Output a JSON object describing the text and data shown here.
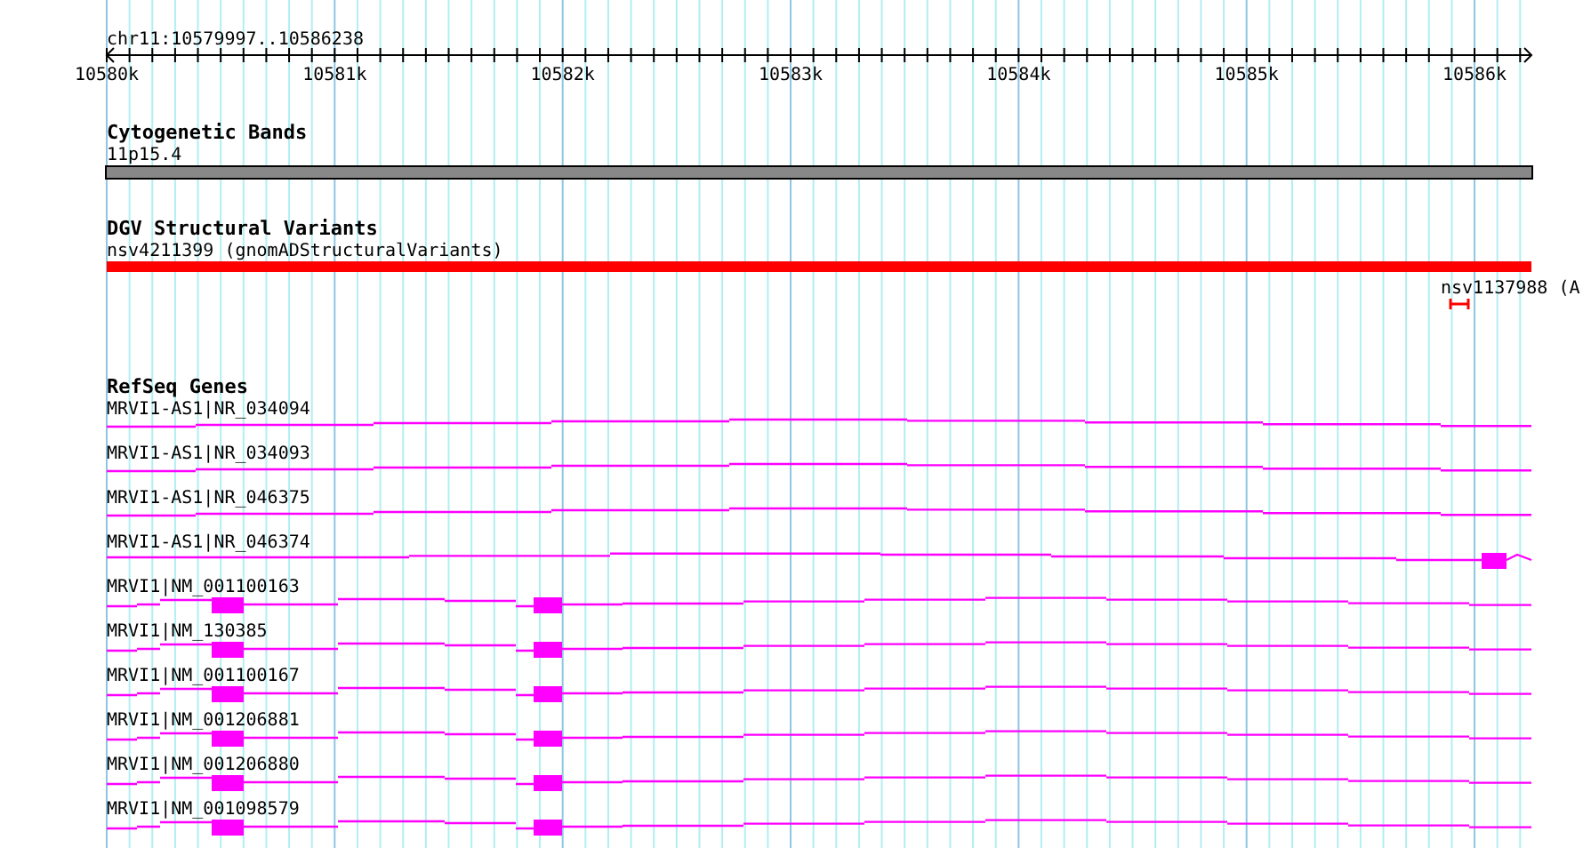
{
  "location": "chr11:10579997..10586238",
  "ruler": {
    "tick_labels": [
      "10580k",
      "10581k",
      "10582k",
      "10583k",
      "10584k",
      "10585k",
      "10586k"
    ]
  },
  "tracks": [
    {
      "kind": "cytoband",
      "title": "Cytogenetic Bands",
      "features": [
        {
          "label": "11p15.4"
        }
      ]
    },
    {
      "kind": "variants",
      "title": "DGV Structural Variants",
      "features": [
        {
          "label": "nsv4211399 (gnomADStructuralVariants)"
        },
        {
          "label": "nsv1137988 (A"
        }
      ]
    },
    {
      "kind": "genes",
      "title": "RefSeq Genes",
      "features": [
        {
          "label": "MRVI1-AS1|NR_034094",
          "kind": "noncoding"
        },
        {
          "label": "MRVI1-AS1|NR_034093",
          "kind": "noncoding"
        },
        {
          "label": "MRVI1-AS1|NR_046375",
          "kind": "noncoding"
        },
        {
          "label": "MRVI1-AS1|NR_046374",
          "kind": "noncoding-exon"
        },
        {
          "label": "MRVI1|NM_001100163",
          "kind": "coding"
        },
        {
          "label": "MRVI1|NM_130385",
          "kind": "coding"
        },
        {
          "label": "MRVI1|NM_001100167",
          "kind": "coding"
        },
        {
          "label": "MRVI1|NM_001206881",
          "kind": "coding"
        },
        {
          "label": "MRVI1|NM_001206880",
          "kind": "coding"
        },
        {
          "label": "MRVI1|NM_001098579",
          "kind": "coding"
        }
      ]
    }
  ]
}
